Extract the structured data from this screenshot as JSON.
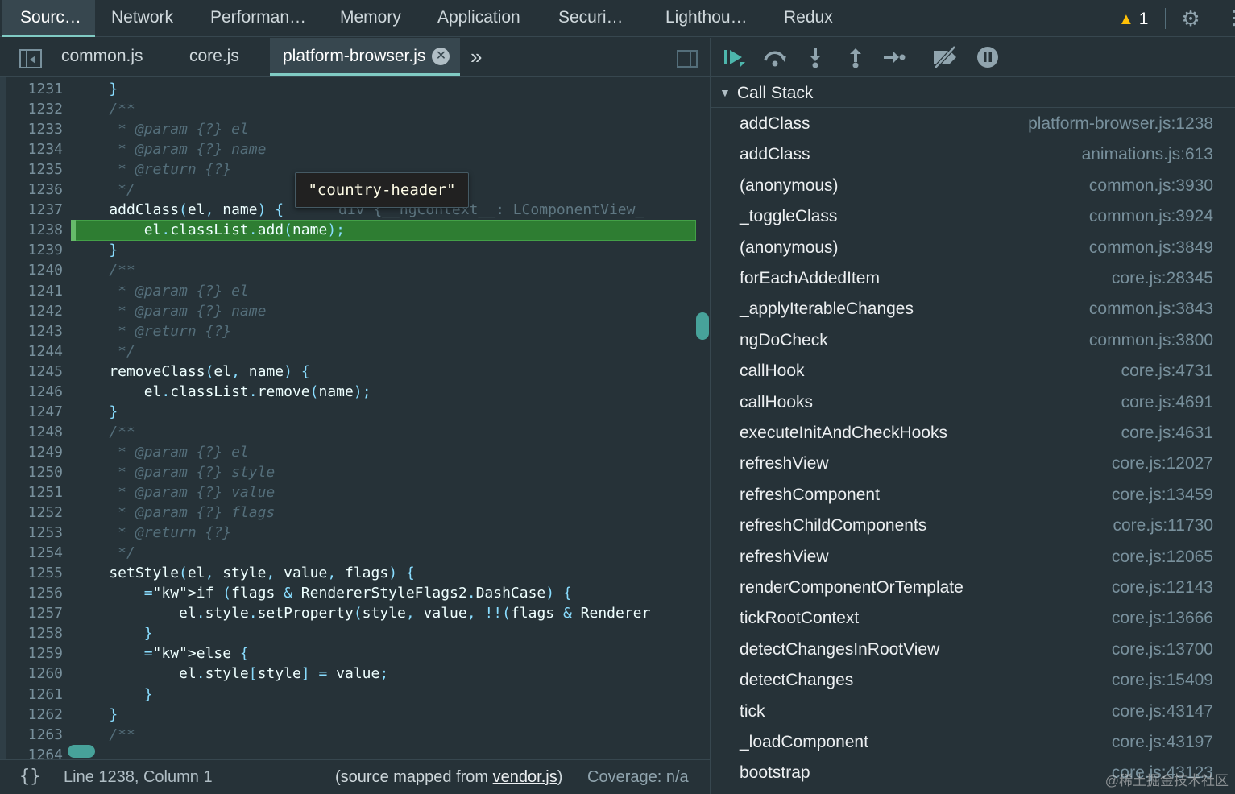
{
  "panel_tabs": [
    "Sourc…",
    "Network",
    "Performan…",
    "Memory",
    "Application",
    "Securi…",
    "Lighthou…",
    "Redux"
  ],
  "warnings": {
    "count": "1"
  },
  "editor": {
    "file_tabs": [
      "common.js",
      "core.js",
      "platform-browser.js"
    ],
    "active_file": "platform-browser.js",
    "more_tabs_label": "»",
    "tooltip": "\"country-header\"",
    "inline_value": "div {__ngContext__: LComponentView_",
    "lines": [
      {
        "n": "1231",
        "t": "    }"
      },
      {
        "n": "1232",
        "t": "    /**"
      },
      {
        "n": "1233",
        "t": "     * @param {?} el"
      },
      {
        "n": "1234",
        "t": "     * @param {?} name"
      },
      {
        "n": "1235",
        "t": "     * @return {?}"
      },
      {
        "n": "1236",
        "t": "     */"
      },
      {
        "n": "1237",
        "t": "    addClass(el, name) {"
      },
      {
        "n": "1238",
        "t": "        el.classList.add(name);"
      },
      {
        "n": "1239",
        "t": "    }"
      },
      {
        "n": "1240",
        "t": "    /**"
      },
      {
        "n": "1241",
        "t": "     * @param {?} el"
      },
      {
        "n": "1242",
        "t": "     * @param {?} name"
      },
      {
        "n": "1243",
        "t": "     * @return {?}"
      },
      {
        "n": "1244",
        "t": "     */"
      },
      {
        "n": "1245",
        "t": "    removeClass(el, name) {"
      },
      {
        "n": "1246",
        "t": "        el.classList.remove(name);"
      },
      {
        "n": "1247",
        "t": "    }"
      },
      {
        "n": "1248",
        "t": "    /**"
      },
      {
        "n": "1249",
        "t": "     * @param {?} el"
      },
      {
        "n": "1250",
        "t": "     * @param {?} style"
      },
      {
        "n": "1251",
        "t": "     * @param {?} value"
      },
      {
        "n": "1252",
        "t": "     * @param {?} flags"
      },
      {
        "n": "1253",
        "t": "     * @return {?}"
      },
      {
        "n": "1254",
        "t": "     */"
      },
      {
        "n": "1255",
        "t": "    setStyle(el, style, value, flags) {"
      },
      {
        "n": "1256",
        "t": "        if (flags & RendererStyleFlags2.DashCase) {"
      },
      {
        "n": "1257",
        "t": "            el.style.setProperty(style, value, !!(flags & Renderer"
      },
      {
        "n": "1258",
        "t": "        }"
      },
      {
        "n": "1259",
        "t": "        else {"
      },
      {
        "n": "1260",
        "t": "            el.style[style] = value;"
      },
      {
        "n": "1261",
        "t": "        }"
      },
      {
        "n": "1262",
        "t": "    }"
      },
      {
        "n": "1263",
        "t": "    /**"
      },
      {
        "n": "1264",
        "t": ""
      }
    ],
    "paused_line": "1238"
  },
  "footer": {
    "braces": "{}",
    "position": "Line 1238, Column 1",
    "source_prefix": "(source mapped from ",
    "source_file": "vendor.js",
    "source_suffix": ")",
    "coverage": "Coverage: n/a"
  },
  "debugger": {
    "buttons": [
      "resume-icon",
      "step-over-icon",
      "step-into-icon",
      "step-out-icon",
      "step-icon",
      "deactivate-breakpoints-icon",
      "pause-on-exceptions-icon"
    ],
    "call_stack_title": "Call Stack",
    "frames": [
      {
        "fn": "addClass",
        "loc": "platform-browser.js:1238"
      },
      {
        "fn": "addClass",
        "loc": "animations.js:613"
      },
      {
        "fn": "(anonymous)",
        "loc": "common.js:3930"
      },
      {
        "fn": "_toggleClass",
        "loc": "common.js:3924"
      },
      {
        "fn": "(anonymous)",
        "loc": "common.js:3849"
      },
      {
        "fn": "forEachAddedItem",
        "loc": "core.js:28345"
      },
      {
        "fn": "_applyIterableChanges",
        "loc": "common.js:3843"
      },
      {
        "fn": "ngDoCheck",
        "loc": "common.js:3800"
      },
      {
        "fn": "callHook",
        "loc": "core.js:4731"
      },
      {
        "fn": "callHooks",
        "loc": "core.js:4691"
      },
      {
        "fn": "executeInitAndCheckHooks",
        "loc": "core.js:4631"
      },
      {
        "fn": "refreshView",
        "loc": "core.js:12027"
      },
      {
        "fn": "refreshComponent",
        "loc": "core.js:13459"
      },
      {
        "fn": "refreshChildComponents",
        "loc": "core.js:11730"
      },
      {
        "fn": "refreshView",
        "loc": "core.js:12065"
      },
      {
        "fn": "renderComponentOrTemplate",
        "loc": "core.js:12143"
      },
      {
        "fn": "tickRootContext",
        "loc": "core.js:13666"
      },
      {
        "fn": "detectChangesInRootView",
        "loc": "core.js:13700"
      },
      {
        "fn": "detectChanges",
        "loc": "core.js:15409"
      },
      {
        "fn": "tick",
        "loc": "core.js:43147"
      },
      {
        "fn": "_loadComponent",
        "loc": "core.js:43197"
      },
      {
        "fn": "bootstrap",
        "loc": "core.js:43123"
      }
    ]
  },
  "watermark": "@稀土掘金技术社区",
  "colors": {
    "accent": "#80cbc4",
    "paused_line": "#2e7d32",
    "background": "#263238"
  }
}
